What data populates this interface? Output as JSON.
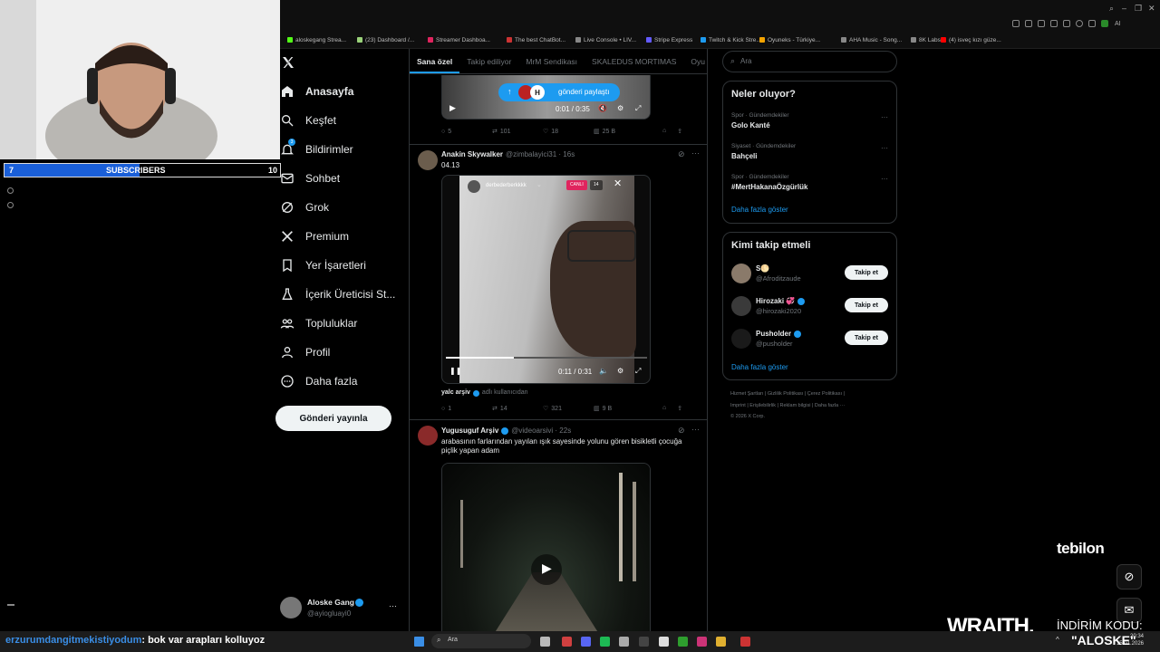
{
  "browser": {
    "bookmarks": [
      {
        "label": "aloskegang Strea...",
        "color": "#53fc18"
      },
      {
        "label": "(23) Dashboard /...",
        "color": "#9ad27a"
      },
      {
        "label": "Streamer Dashboa...",
        "color": "#e0245e"
      },
      {
        "label": "The best ChatBot...",
        "color": "#cc3333"
      },
      {
        "label": "Live Console • LIV...",
        "color": "#888888"
      },
      {
        "label": "Stripe Express",
        "color": "#635bff"
      },
      {
        "label": "Twitch & Kick Stre...",
        "color": "#1d9bf0"
      },
      {
        "label": "Oyuneks - Türkiye...",
        "color": "#f4a300"
      },
      {
        "label": "AHA Music - Song...",
        "color": "#888888"
      },
      {
        "label": "8K Labs",
        "color": "#888888"
      },
      {
        "label": "(4) isveç kızı güze...",
        "color": "#ff0000"
      }
    ]
  },
  "overlay": {
    "subscribers": {
      "left": "7",
      "label": "SUBSCRIBERS",
      "right": "10",
      "progress": 0.7
    },
    "chat_user": "erzurumdangitmekistiyodum",
    "chat_message": ": bok var arapları kolluyoz",
    "sponsor_logo": "tebilon",
    "wraith_logo": "WRAITH.",
    "discount_label": "İNDİRİM KODU:",
    "discount_code": "\"ALOSKE\""
  },
  "sidebar": {
    "nav": [
      {
        "label": "Anasayfa",
        "icon": "home-icon",
        "bold": true
      },
      {
        "label": "Keşfet",
        "icon": "search-icon"
      },
      {
        "label": "Bildirimler",
        "icon": "bell-icon",
        "badge": "3"
      },
      {
        "label": "Sohbet",
        "icon": "mail-icon"
      },
      {
        "label": "Grok",
        "icon": "grok-icon"
      },
      {
        "label": "Premium",
        "icon": "x-logo-icon"
      },
      {
        "label": "Yer İşaretleri",
        "icon": "bookmark-icon"
      },
      {
        "label": "İçerik Üreticisi St...",
        "icon": "flask-icon"
      },
      {
        "label": "Topluluklar",
        "icon": "people-icon"
      },
      {
        "label": "Profil",
        "icon": "person-icon"
      },
      {
        "label": "Daha fazla",
        "icon": "more-circle-icon"
      }
    ],
    "post_button": "Gönderi yayınla",
    "account": {
      "name": "Aloske Gang",
      "handle": "@ayiogluayi0"
    }
  },
  "timeline": {
    "tabs": [
      "Sana özel",
      "Takip ediliyor",
      "MrM Sendikası",
      "SKALEDUS MORTIMAS",
      "Oyu"
    ],
    "top_post": {
      "video_time": "0:01 / 0:35",
      "pill_label": "gönderi paylaştı",
      "pill_badge": "H",
      "replies": "5",
      "reposts": "101",
      "likes": "18",
      "views": "25 B"
    },
    "post1": {
      "name": "Anakin Skywalker",
      "handle": "@zimbalayici31 · 16s",
      "text": "04.13",
      "video_user": "derbederberkkkk",
      "live_badge": "CANLI",
      "viewers": "14",
      "video_time": "0:11 / 0:31",
      "source_name": "yalc arşiv",
      "source_suffix": "adlı kullanıcıdan",
      "replies": "1",
      "reposts": "14",
      "likes": "321",
      "views": "9 B"
    },
    "post2": {
      "name": "Yugusuguf Arşiv",
      "handle": "@videoarsivi · 22s",
      "text": "arabasının farlarından yayılan ışık sayesinde yolunu gören bisikletli çocuğa piçlik yapan adam"
    }
  },
  "right": {
    "search_placeholder": "Ara",
    "trends_title": "Neler oluyor?",
    "trends": [
      {
        "category": "Spor · Gündemdekiler",
        "name": "Golo Kanté"
      },
      {
        "category": "Siyaset · Gündemdekiler",
        "name": "Bahçeli"
      },
      {
        "category": "Spor · Gündemdekiler",
        "name": "#MertHakanaÖzgürlük"
      }
    ],
    "show_more": "Daha fazla göster",
    "who_title": "Kimi takip etmeli",
    "who": [
      {
        "name": "S🌕",
        "handle": "@Afroditzaude",
        "verified": false
      },
      {
        "name": "Hirozaki 💞",
        "handle": "@hirozaki2020",
        "verified": true
      },
      {
        "name": "Pusholder",
        "handle": "@pusholder",
        "verified": true
      }
    ],
    "follow_label": "Takip et",
    "footer1": "Hizmet Şartları  |  Gizlilik Politikası  |  Çerez Politikası  |",
    "footer2": "Imprint  |  Erişilebilirlik  |  Reklam bilgisi  |  Daha fazla ···",
    "footer3": "© 2026 X Corp."
  },
  "taskbar": {
    "search": "Ara",
    "time": "20:34",
    "date": "15.01.2026"
  }
}
